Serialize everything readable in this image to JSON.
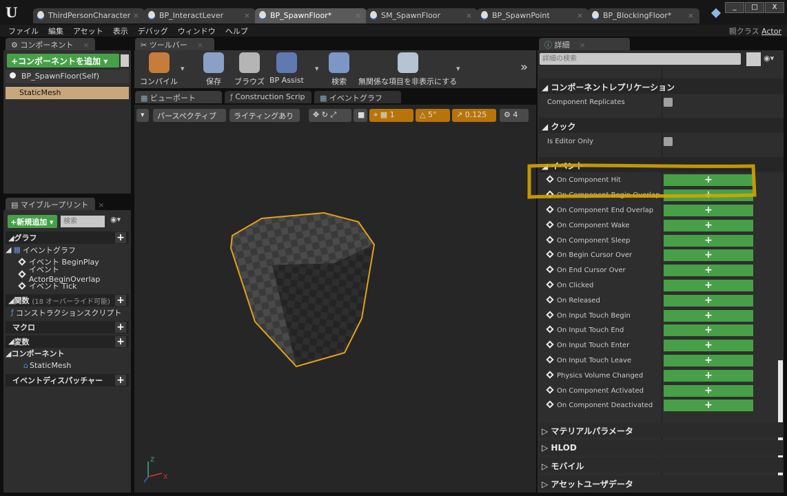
{
  "title_tabs": [
    {
      "label": "ThirdPersonCharacter"
    },
    {
      "label": "BP_InteractLever"
    },
    {
      "label": "BP_SpawnFloor*",
      "active": true
    },
    {
      "label": "SM_SpawnFloor"
    },
    {
      "label": "BP_SpawnPoint"
    },
    {
      "label": "BP_BlockingFloor*"
    }
  ],
  "window_buttons": [
    "_",
    "□",
    "X"
  ],
  "menu": [
    "ファイル",
    "編集",
    "アセット",
    "表示",
    "デバッグ",
    "ウィンドウ",
    "ヘルプ"
  ],
  "parent_class": {
    "label": "親クラス",
    "value": "Actor"
  },
  "components": {
    "tab": "コンポーネント",
    "add_button": "+コンポーネントを追加",
    "items": [
      "BP_SpawnFloor(Self)",
      "StaticMesh"
    ]
  },
  "my_blueprint": {
    "tab": "マイブループリント",
    "add_button": "+新規追加",
    "search_placeholder": "検索",
    "graph": "グラフ",
    "event_graph": "イベントグラフ",
    "events": [
      "イベント BeginPlay",
      "イベント ActorBeginOverlap",
      "イベント Tick"
    ],
    "functions": "関数",
    "functions_note": "(18 オーバーライド可能)",
    "construction_script": "コンストラクションスクリプト",
    "macros": "マクロ",
    "variables": "変数",
    "components": "コンポーネント",
    "static_mesh": "StaticMesh",
    "dispatchers": "イベントディスパッチャー"
  },
  "toolbar": {
    "tab": "ツールバー",
    "buttons": [
      "コンパイル",
      "保存",
      "ブラウズ",
      "BP Assist",
      "検索",
      "無関係な項目を非表示にする"
    ]
  },
  "editor_tabs": [
    "ビューポート",
    "Construction Scrip",
    "イベントグラフ"
  ],
  "viewport": {
    "perspective": "パースペクティブ",
    "lighting": "ライティングあり",
    "grid": "1",
    "rotation": "5°",
    "scale": "0.125",
    "camera_speed": "4"
  },
  "details": {
    "tab": "詳細",
    "search_placeholder": "詳細の検索",
    "sections": [
      {
        "title": "コンポーネントレプリケーション",
        "props": [
          "Component Replicates"
        ]
      },
      {
        "title": "クック",
        "props": [
          "Is Editor Only"
        ]
      }
    ],
    "events_title": "イベント",
    "events": [
      "On Component Hit",
      "On Component Begin Overlap",
      "On Component End Overlap",
      "On Component Wake",
      "On Component Sleep",
      "On Begin Cursor Over",
      "On End Cursor Over",
      "On Clicked",
      "On Released",
      "On Input Touch Begin",
      "On Input Touch End",
      "On Input Touch Enter",
      "On Input Touch Leave",
      "Physics Volume Changed",
      "On Component Activated",
      "On Component Deactivated"
    ],
    "collapsed": [
      "マテリアルパラメータ",
      "HLOD",
      "モバイル",
      "アセットユーザデータ"
    ],
    "add_label": "+"
  },
  "colors": {
    "accent_green": "#47a047",
    "highlight": "#d4a400",
    "selection": "#c9a77d",
    "orange": "#b8740b"
  }
}
